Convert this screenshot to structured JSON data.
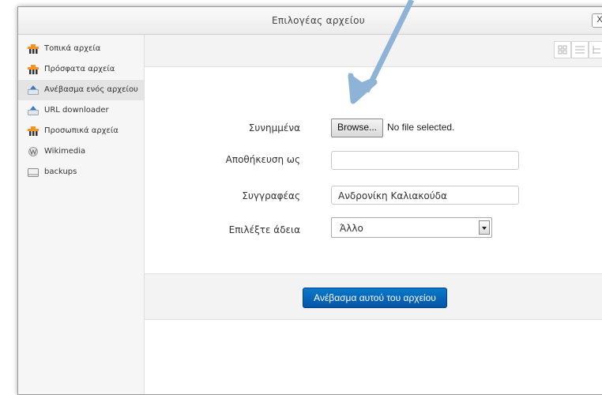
{
  "dialog": {
    "title": "Επιλογέας αρχείου",
    "close_label": "X"
  },
  "sidebar": {
    "items": [
      {
        "label": "Τοπικά αρχεία",
        "icon": "moodle-icon",
        "active": false
      },
      {
        "label": "Πρόσφατα αρχεία",
        "icon": "moodle-icon",
        "active": false
      },
      {
        "label": "Ανέβασμα ενός αρχείου",
        "icon": "upload-icon",
        "active": true
      },
      {
        "label": "URL downloader",
        "icon": "upload-icon",
        "active": false
      },
      {
        "label": "Προσωπικά αρχεία",
        "icon": "moodle-icon",
        "active": false
      },
      {
        "label": "Wikimedia",
        "icon": "wikimedia-icon",
        "active": false
      },
      {
        "label": "backups",
        "icon": "box-icon",
        "active": false
      }
    ]
  },
  "form": {
    "attachments_label": "Συνημμένα",
    "browse_label": "Browse...",
    "no_file_text": "No file selected.",
    "save_as_label": "Αποθήκευση ως",
    "save_as_value": "",
    "author_label": "Συγγραφέας",
    "author_value": "Ανδρονίκη Καλιακούδα",
    "license_label": "Επιλέξτε άδεια",
    "license_value": "Άλλο"
  },
  "footer": {
    "upload_button_label": "Ανέβασμα αυτού του αρχείου"
  },
  "colors": {
    "accent": "#0a6cbf",
    "annotation_arrow": "#8fb3d6"
  }
}
